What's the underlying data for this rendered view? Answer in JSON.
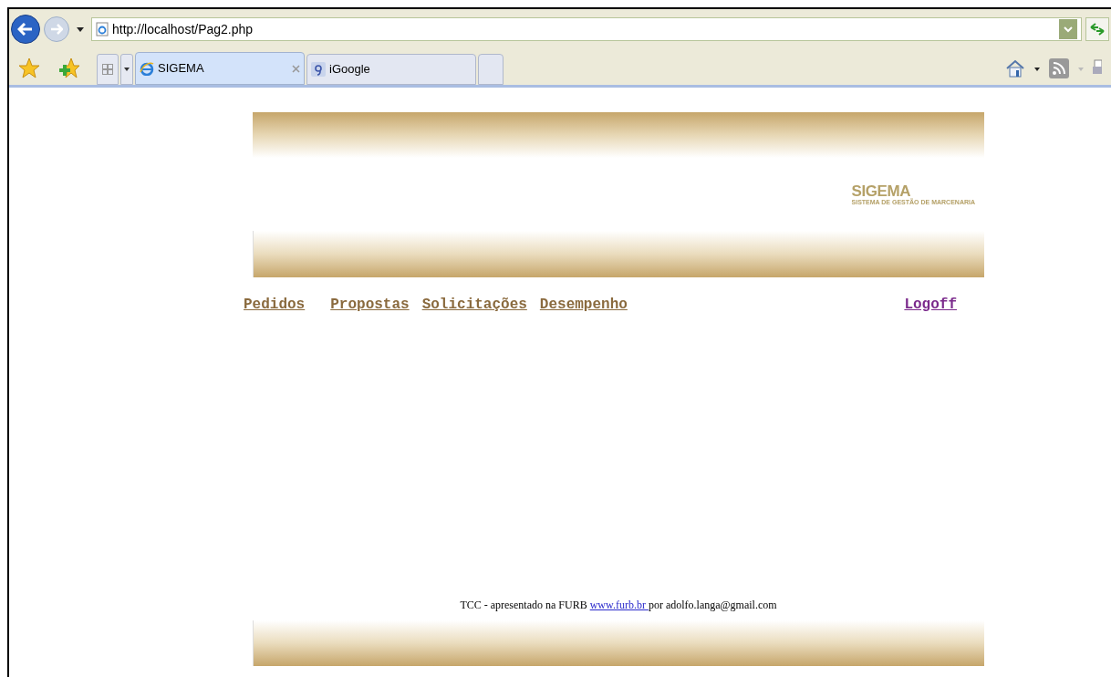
{
  "browser": {
    "address": "http://localhost/Pag2.php",
    "tabs": [
      {
        "label": "SIGEMA",
        "selected": true,
        "kind": "ie"
      },
      {
        "label": "iGoogle",
        "selected": false,
        "kind": "google"
      }
    ]
  },
  "header": {
    "logo_title": "SIGEMA",
    "logo_subtitle": "SISTEMA DE GESTÃO DE MARCENARIA"
  },
  "nav": [
    {
      "label": "Pedidos",
      "visited": false
    },
    {
      "label": "Propostas",
      "visited": false
    },
    {
      "label": "Solicitações",
      "visited": false
    },
    {
      "label": "Desempenho",
      "visited": false
    },
    {
      "label": "Logoff",
      "visited": true
    }
  ],
  "footer": {
    "text_before": "TCC - apresentado na FURB ",
    "link": "www.furb.br ",
    "text_after": "por adolfo.langa@gmail.com"
  }
}
